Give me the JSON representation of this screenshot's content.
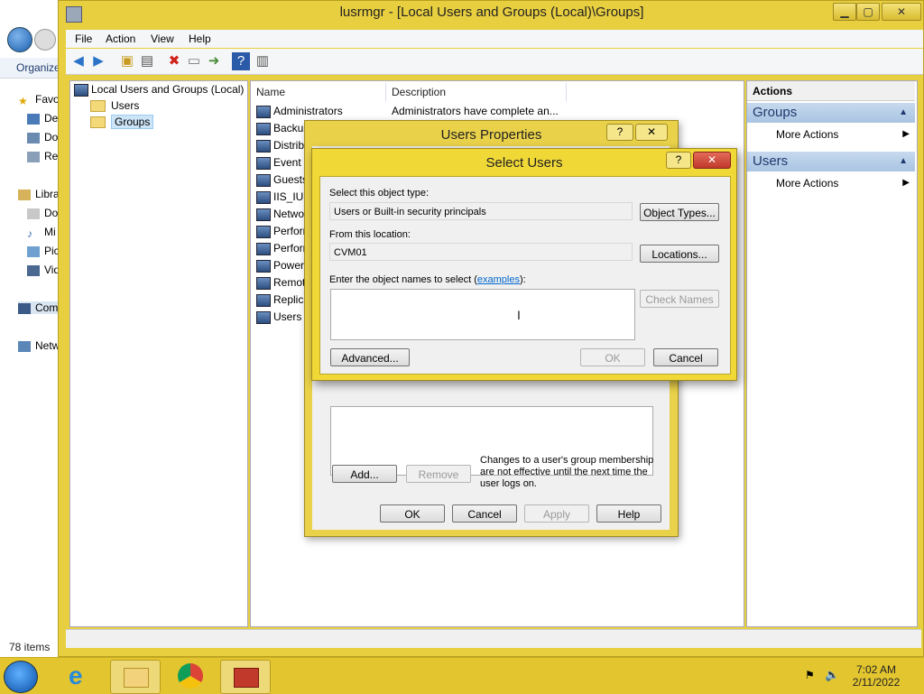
{
  "explorer": {
    "organize": "Organize",
    "nav": [
      "Favo",
      "De",
      "Do",
      "Re",
      "Libra",
      "Do",
      "Mi",
      "Pic",
      "Vid",
      "Com",
      "Netw"
    ],
    "items_count": "78 items"
  },
  "mmc": {
    "title": "lusrmgr - [Local Users and Groups (Local)\\Groups]",
    "menus": [
      "File",
      "Action",
      "View",
      "Help"
    ],
    "tree": {
      "root": "Local Users and Groups (Local)",
      "children": [
        "Users",
        "Groups"
      ]
    },
    "list": {
      "columns": [
        "Name",
        "Description"
      ],
      "rows": [
        {
          "name": "Administrators",
          "description": "Administrators have complete an..."
        },
        {
          "name": "Backup",
          "description": ""
        },
        {
          "name": "Distribu",
          "description": ""
        },
        {
          "name": "Event L",
          "description": ""
        },
        {
          "name": "Guests",
          "description": ""
        },
        {
          "name": "IIS_IUSR",
          "description": ""
        },
        {
          "name": "Networ",
          "description": ""
        },
        {
          "name": "Perforn",
          "description": ""
        },
        {
          "name": "Perforn",
          "description": ""
        },
        {
          "name": "Power U",
          "description": ""
        },
        {
          "name": "Remote",
          "description": ""
        },
        {
          "name": "Replica",
          "description": ""
        },
        {
          "name": "Users",
          "description": ""
        }
      ]
    },
    "actions": {
      "header": "Actions",
      "sections": [
        {
          "title": "Groups",
          "more": "More Actions"
        },
        {
          "title": "Users",
          "more": "More Actions"
        }
      ]
    }
  },
  "props_dialog": {
    "title": "Users Properties",
    "note": "Changes to a user's group membership are not effective until the next time the user logs on.",
    "add": "Add...",
    "remove": "Remove",
    "ok": "OK",
    "cancel": "Cancel",
    "apply": "Apply",
    "help": "Help"
  },
  "select_dialog": {
    "title": "Select Users",
    "object_type_label": "Select this object type:",
    "object_type_value": "Users or Built-in security principals",
    "object_types_btn": "Object Types...",
    "location_label": "From this location:",
    "location_value": "CVM01",
    "locations_btn": "Locations...",
    "names_label_pre": "Enter the object names to select (",
    "names_label_link": "examples",
    "names_label_post": "):",
    "check_names_btn": "Check Names",
    "advanced_btn": "Advanced...",
    "ok_btn": "OK",
    "cancel_btn": "Cancel"
  },
  "taskbar": {
    "time": "7:02 AM",
    "date": "2/11/2022"
  }
}
